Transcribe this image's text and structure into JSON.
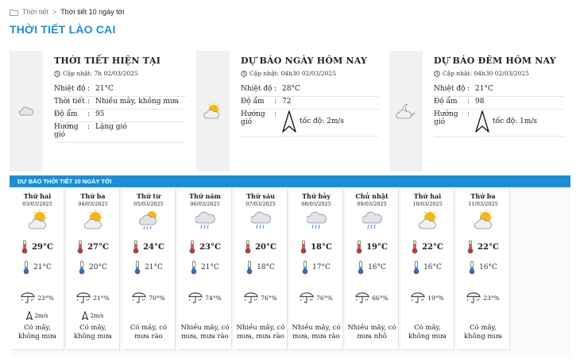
{
  "breadcrumb": {
    "home": "Thời tiết",
    "separator": ">",
    "current": "Thời tiết 10 ngày tới"
  },
  "page_title": "THỜI TIẾT LÀO CAI",
  "cards": [
    {
      "title": "THỜI TIẾT HIỆN TẠI",
      "updated": "Cập nhật: 7h 02/03/2025",
      "icon": "cloudy-icon",
      "rows": [
        {
          "label": "Nhiệt độ",
          "value": "21°C"
        },
        {
          "label": "Thời tiết",
          "value": "Nhiều mây, không mưa"
        },
        {
          "label": "Độ ẩm",
          "value": "95"
        },
        {
          "label": "Hướng gió",
          "value": "Lặng gió"
        }
      ]
    },
    {
      "title": "DỰ BÁO NGÀY HÔM NAY",
      "updated": "Cập nhật: 04h30 02/03/2025",
      "icon": "sun-cloud-icon",
      "rows": [
        {
          "label": "Nhiệt độ",
          "value": "28°C"
        },
        {
          "label": "Độ ẩm",
          "value": "72"
        },
        {
          "label": "Hướng gió",
          "value": "tốc độ: 2m/s"
        }
      ]
    },
    {
      "title": "DỰ BÁO ĐÊM HÔM NAY",
      "updated": "Cập nhật: 04h30 02/03/2025",
      "icon": "moon-cloud-icon",
      "rows": [
        {
          "label": "Nhiệt độ",
          "value": "21°C"
        },
        {
          "label": "Độ ẩm",
          "value": "98"
        },
        {
          "label": "Hướng gió",
          "value": "tốc độ: 1m/s"
        }
      ]
    }
  ],
  "forecast_title": "DỰ BÁO THỜI TIẾT 10 NGÀY TỚI",
  "days": [
    {
      "name": "Thứ hai",
      "date": "03/03/2025",
      "icon": "sun-cloud-icon",
      "high": "29°C",
      "low": "21°C",
      "rain": "23°%",
      "wind": "2m/s",
      "desc": "Có mây, không mưa"
    },
    {
      "name": "Thứ ba",
      "date": "04/03/2025",
      "icon": "sun-cloud-icon",
      "high": "27°C",
      "low": "20°C",
      "rain": "21°%",
      "wind": "2m/s",
      "desc": "Có mây, không mưa"
    },
    {
      "name": "Thứ tư",
      "date": "05/03/2025",
      "icon": "sun-rain-icon",
      "high": "24°C",
      "low": "21°C",
      "rain": "70°%",
      "wind": "",
      "desc": "Có mây, có mưa rào"
    },
    {
      "name": "Thứ năm",
      "date": "06/03/2025",
      "icon": "rain-cloud-icon",
      "high": "23°C",
      "low": "21°C",
      "rain": "74°%",
      "wind": "",
      "desc": "Nhiều mây, có mưa, mưa rào"
    },
    {
      "name": "Thứ sáu",
      "date": "07/03/2025",
      "icon": "rain-cloud-icon",
      "high": "20°C",
      "low": "18°C",
      "rain": "76°%",
      "wind": "",
      "desc": "Nhiều mây, có mưa, mưa rào"
    },
    {
      "name": "Thứ bảy",
      "date": "08/03/2025",
      "icon": "rain-cloud-icon",
      "high": "18°C",
      "low": "17°C",
      "rain": "76°%",
      "wind": "",
      "desc": "Nhiều mây, có mưa, mưa rào"
    },
    {
      "name": "Chủ nhật",
      "date": "09/03/2025",
      "icon": "rain-cloud-icon",
      "high": "19°C",
      "low": "16°C",
      "rain": "66°%",
      "wind": "",
      "desc": "Nhiều mây, có mưa nhỏ"
    },
    {
      "name": "Thứ hai",
      "date": "10/03/2025",
      "icon": "sun-cloud-icon",
      "high": "22°C",
      "low": "16°C",
      "rain": "19°%",
      "wind": "",
      "desc": "Có mây, không mưa"
    },
    {
      "name": "Thứ ba",
      "date": "11/03/2025",
      "icon": "sun-cloud-icon",
      "high": "22°C",
      "low": "16°C",
      "rain": "23°%",
      "wind": "",
      "desc": "Có mây, không mưa"
    }
  ],
  "colors": {
    "accent": "#1a8fd6",
    "sun": "#f5b81c",
    "cloud": "#c9ced6",
    "high_temp": "#d62d2d",
    "low_temp": "#2a6fd6"
  }
}
